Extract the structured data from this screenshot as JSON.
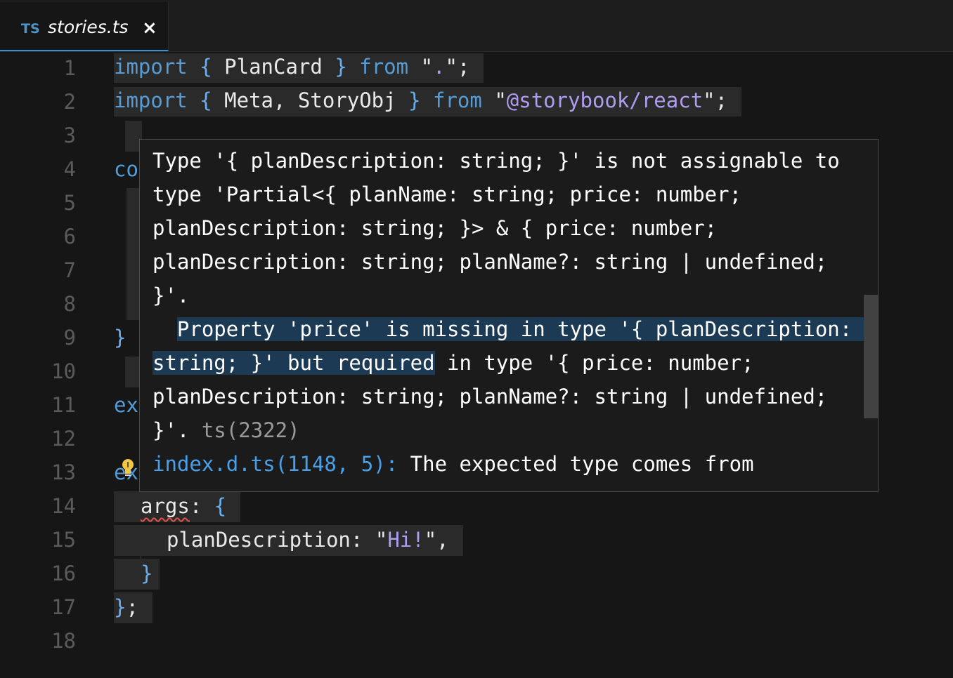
{
  "tab": {
    "badge": "TS",
    "filename": "stories.ts",
    "close": "×"
  },
  "line_numbers": [
    "1",
    "2",
    "3",
    "4",
    "5",
    "6",
    "7",
    "8",
    "9",
    "10",
    "11",
    "12",
    "13",
    "14",
    "15",
    "16",
    "17",
    "18"
  ],
  "code": {
    "l1": {
      "import": "import",
      "open": "{",
      "name": "PlanCard",
      "close": "}",
      "from": "from",
      "q1": "\"",
      "path": ".",
      "q2": "\"",
      "semi": ";"
    },
    "l2": {
      "import": "import",
      "open": "{",
      "names": "Meta, StoryObj",
      "close": "}",
      "from": "from",
      "q1": "\"",
      "path": "@storybook/react",
      "q2": "\"",
      "semi": ";"
    },
    "l4_partial": "co",
    "l9_brace": "}",
    "l11_partial": "ex",
    "l13_partial": "ex",
    "l14": {
      "key": "args",
      "colon": ":",
      "brace": "{"
    },
    "l15": {
      "key": "planDescription",
      "colon": ":",
      "q1": "\"",
      "value": "Hi!",
      "q2": "\"",
      "comma": ","
    },
    "l16": "}",
    "l17": {
      "brace": "}",
      "semi": ";"
    }
  },
  "hover": {
    "p1": "Type '{ planDescription: string; }' is not assignable to type 'Partial<{ planName: string; price: number; planDescription: string; }> & { price: number; planDescription: string; planName?: string | undefined; }'.",
    "p2_indent": "  ",
    "p2_sel": "Property 'price' is missing in type '{ planDescription: string; }' but required",
    "p2_rest": " in type '{ price: number; planDescription: string; planName?: string | undefined; }'.",
    "code_ref": " ts(2322)",
    "related_link": "index.d.ts(1148, 5):",
    "related_text": " The expected type comes from"
  },
  "icons": {
    "lightbulb": "lightbulb-icon",
    "close": "close-icon"
  },
  "colors": {
    "keyword": "#569cd6",
    "string": "#b09cf0",
    "error": "#e05252",
    "tab_accent": "#3b8fd6"
  }
}
